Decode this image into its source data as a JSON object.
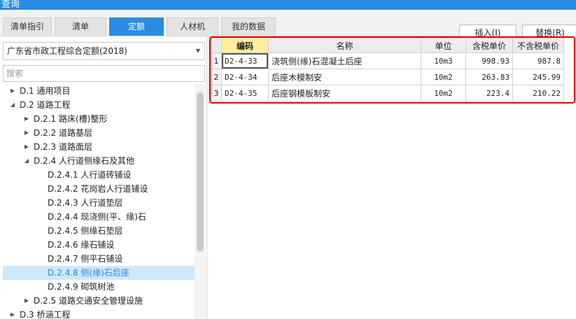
{
  "window": {
    "title": "查询"
  },
  "tabs": [
    {
      "label": "清单指引"
    },
    {
      "label": "清单"
    },
    {
      "label": "定额",
      "active": true
    },
    {
      "label": "人材机"
    },
    {
      "label": "我的数据"
    }
  ],
  "toolbar": {
    "insert_label": "插入(I)",
    "replace_label": "替换(R)"
  },
  "left_panel": {
    "quota_library": "广东省市政工程综合定额(2018)",
    "search_placeholder": "搜索",
    "tree": [
      {
        "label": "D.1 通用项目",
        "level": 0,
        "toggle": "collapsed"
      },
      {
        "label": "D.2 道路工程",
        "level": 0,
        "toggle": "expanded"
      },
      {
        "label": "D.2.1 路床(槽)整形",
        "level": 1,
        "toggle": "collapsed"
      },
      {
        "label": "D.2.2 道路基层",
        "level": 1,
        "toggle": "collapsed"
      },
      {
        "label": "D.2.3 道路面层",
        "level": 1,
        "toggle": "collapsed"
      },
      {
        "label": "D.2.4 人行道侧缘石及其他",
        "level": 1,
        "toggle": "expanded"
      },
      {
        "label": "D.2.4.1 人行道砖铺设",
        "level": 2,
        "toggle": "none"
      },
      {
        "label": "D.2.4.2 花岗岩人行道铺设",
        "level": 2,
        "toggle": "none"
      },
      {
        "label": "D.2.4.3 人行道垫层",
        "level": 2,
        "toggle": "none"
      },
      {
        "label": "D.2.4.4 现浇侧(平、缘)石",
        "level": 2,
        "toggle": "none"
      },
      {
        "label": "D.2.4.5 侧缘石垫层",
        "level": 2,
        "toggle": "none"
      },
      {
        "label": "D.2.4.6 缘石铺设",
        "level": 2,
        "toggle": "none"
      },
      {
        "label": "D.2.4.7 侧平石铺设",
        "level": 2,
        "toggle": "none"
      },
      {
        "label": "D.2.4.8 侧(缘)石后座",
        "level": 2,
        "toggle": "none",
        "selected": true
      },
      {
        "label": "D.2.4.9 砌筑树池",
        "level": 2,
        "toggle": "none"
      },
      {
        "label": "D.2.5 道路交通安全管理设施",
        "level": 1,
        "toggle": "collapsed"
      },
      {
        "label": "D.3 桥涵工程",
        "level": 0,
        "toggle": "collapsed"
      }
    ]
  },
  "grid": {
    "columns": [
      "",
      "编码",
      "名称",
      "单位",
      "含税单价",
      "不含税单价"
    ],
    "rows": [
      {
        "n": "1",
        "code": "D2-4-33",
        "name": "浇筑侧(缘)石混凝土后座",
        "unit": "10m3",
        "price_tax": "998.93",
        "price_notax": "987.8"
      },
      {
        "n": "2",
        "code": "D2-4-34",
        "name": "后座木模制安",
        "unit": "10m2",
        "price_tax": "263.83",
        "price_notax": "245.99"
      },
      {
        "n": "3",
        "code": "D2-4-35",
        "name": "后座钢模板制安",
        "unit": "10m2",
        "price_tax": "223.4",
        "price_notax": "210.22"
      }
    ]
  },
  "colors": {
    "accent": "#2a8ce0",
    "highlight_box": "#e60000",
    "header_highlight": "#ffef9a",
    "tree_selected_bg": "#cde8fb"
  },
  "icons": {
    "collapsed": "triangle-right-icon",
    "expanded": "triangle-down-icon",
    "dropdown": "chevron-down-icon"
  }
}
